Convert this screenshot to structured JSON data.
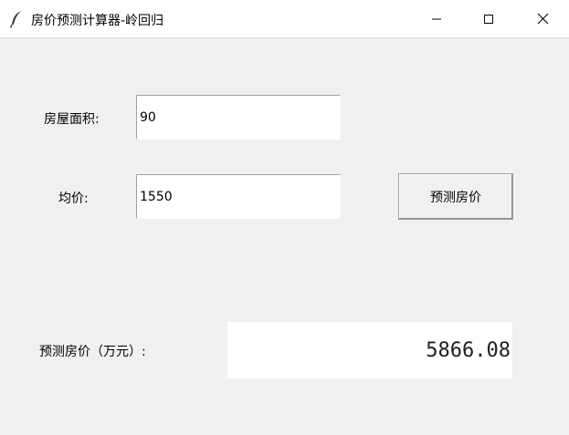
{
  "window": {
    "title": "房价预测计算器-岭回归",
    "icon": "feather-icon",
    "controls": [
      "minimize-icon",
      "maximize-icon",
      "close-icon"
    ]
  },
  "form": {
    "area_label": "房屋面积:",
    "area_value": "90",
    "price_label": "均价:",
    "price_value": "1550",
    "predict_button_label": "预测房价",
    "result_label": "预测房价（万元）:",
    "result_value": "5866.08"
  },
  "colors": {
    "window_bg": "#f0f0f0",
    "titlebar_bg": "#ffffff",
    "field_bg": "#ffffff",
    "text": "#000000"
  }
}
